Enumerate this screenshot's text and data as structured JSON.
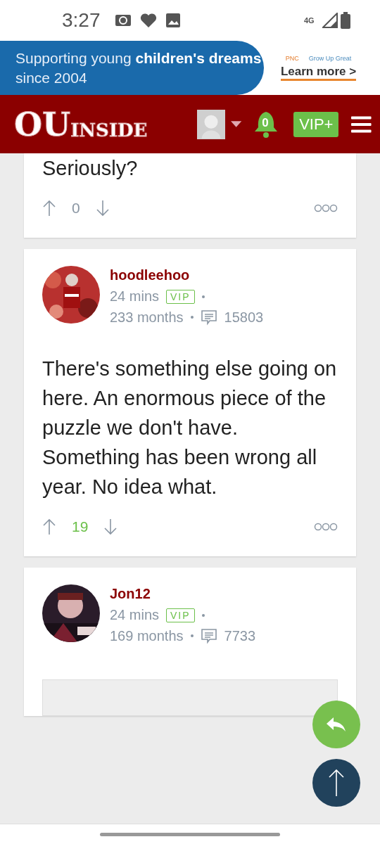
{
  "status_bar": {
    "time": "3:27",
    "network": "4G"
  },
  "ad": {
    "headline": "Supporting young **children's** **dreams** since 2004",
    "brand": "PNC",
    "tagline": "Grow Up Great",
    "cta": "Learn more >"
  },
  "header": {
    "logo_main": "OU",
    "logo_rest": "INSIDE",
    "notifications": "0",
    "vip_button": "VIP+"
  },
  "posts": [
    {
      "kind": "partial",
      "body": "Seriously?",
      "score": "0",
      "score_positive": false
    },
    {
      "kind": "full",
      "username": "hoodleehoo",
      "time": "24 mins",
      "badge": "VIP",
      "tenure": "233 months",
      "post_count": "15803",
      "body": "There's something else going on here. An enormous piece of the puzzle we don't have. Something has been wrong all year. No idea what.",
      "score": "19",
      "score_positive": true
    },
    {
      "kind": "quoted",
      "username": "Jon12",
      "time": "24 mins",
      "badge": "VIP",
      "tenure": "169 months",
      "post_count": "7733"
    }
  ]
}
